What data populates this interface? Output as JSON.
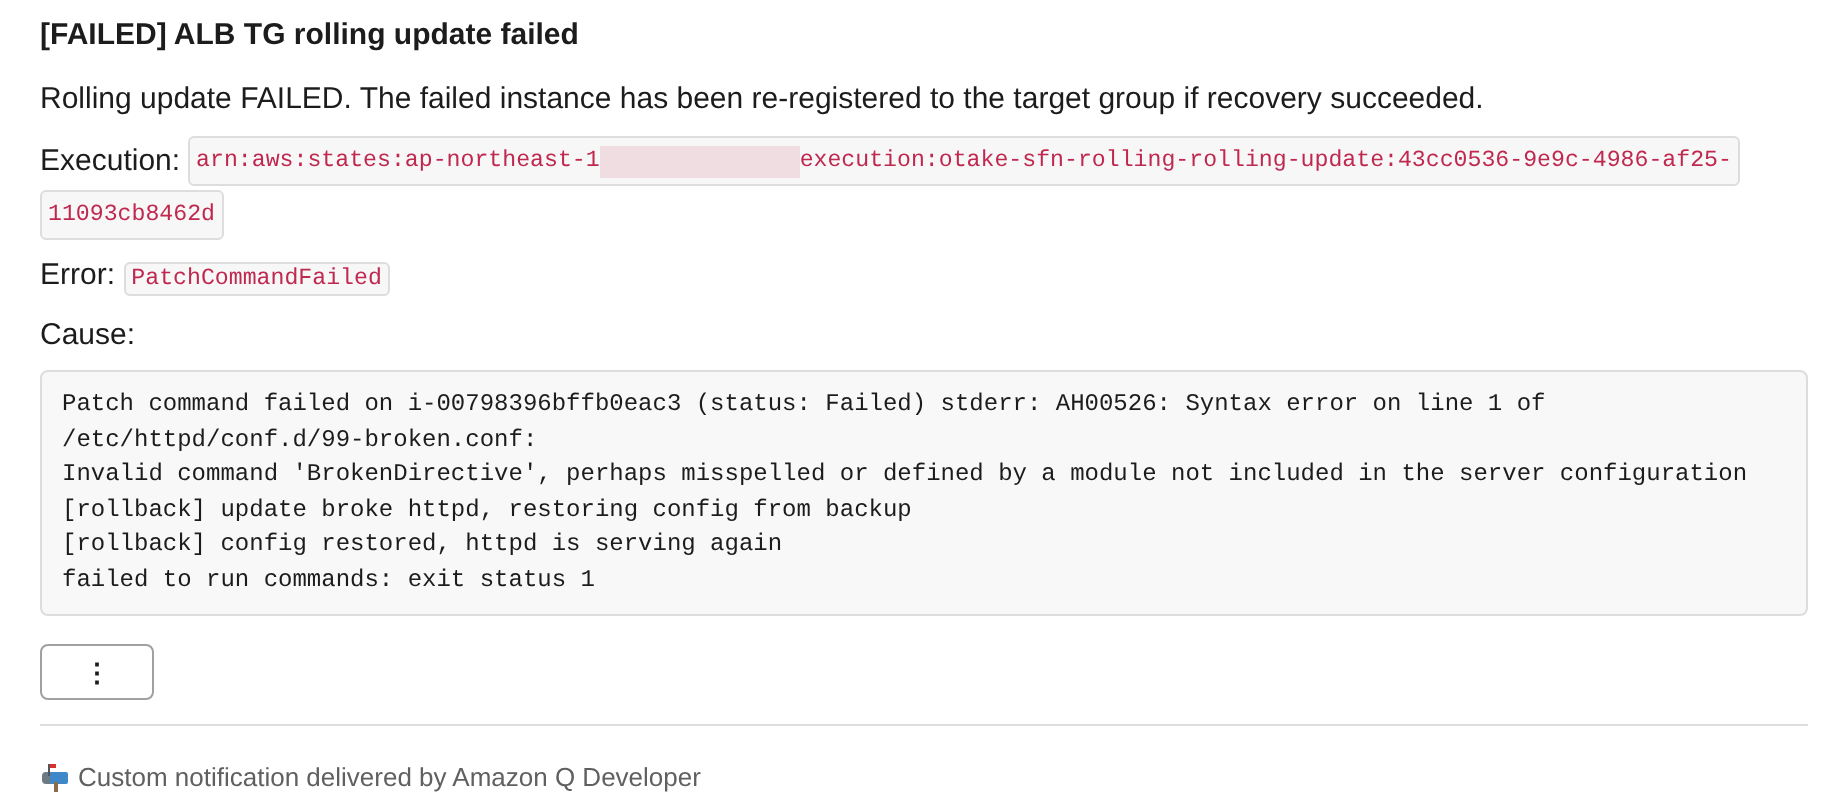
{
  "title": "[FAILED] ALB TG rolling update failed",
  "summary": "Rolling update FAILED. The failed instance has been re-registered to the target group if recovery succeeded.",
  "execution": {
    "label": "Execution:",
    "value_start": "arn:aws:states:ap-northeast-1",
    "redacted": true,
    "value_end": "execution:otake-sfn-rolling-rolling-update:43cc0536-9e9c-4986-af25-",
    "value_continued": "11093cb8462d"
  },
  "error": {
    "label": "Error:",
    "value": "PatchCommandFailed"
  },
  "cause": {
    "label": "Cause:",
    "lines": [
      "Patch command failed on i-00798396bffb0eac3 (status: Failed) stderr: AH00526: Syntax error on line 1 of /etc/httpd/conf.d/99-broken.conf:",
      "Invalid command 'BrokenDirective', perhaps misspelled or defined by a module not included in the server configuration",
      "[rollback] update broke httpd, restoring config from backup",
      "[rollback] config restored, httpd is serving again",
      "failed to run commands: exit status 1"
    ]
  },
  "more_button": "⋮",
  "footer": "Custom notification delivered by Amazon Q Developer"
}
